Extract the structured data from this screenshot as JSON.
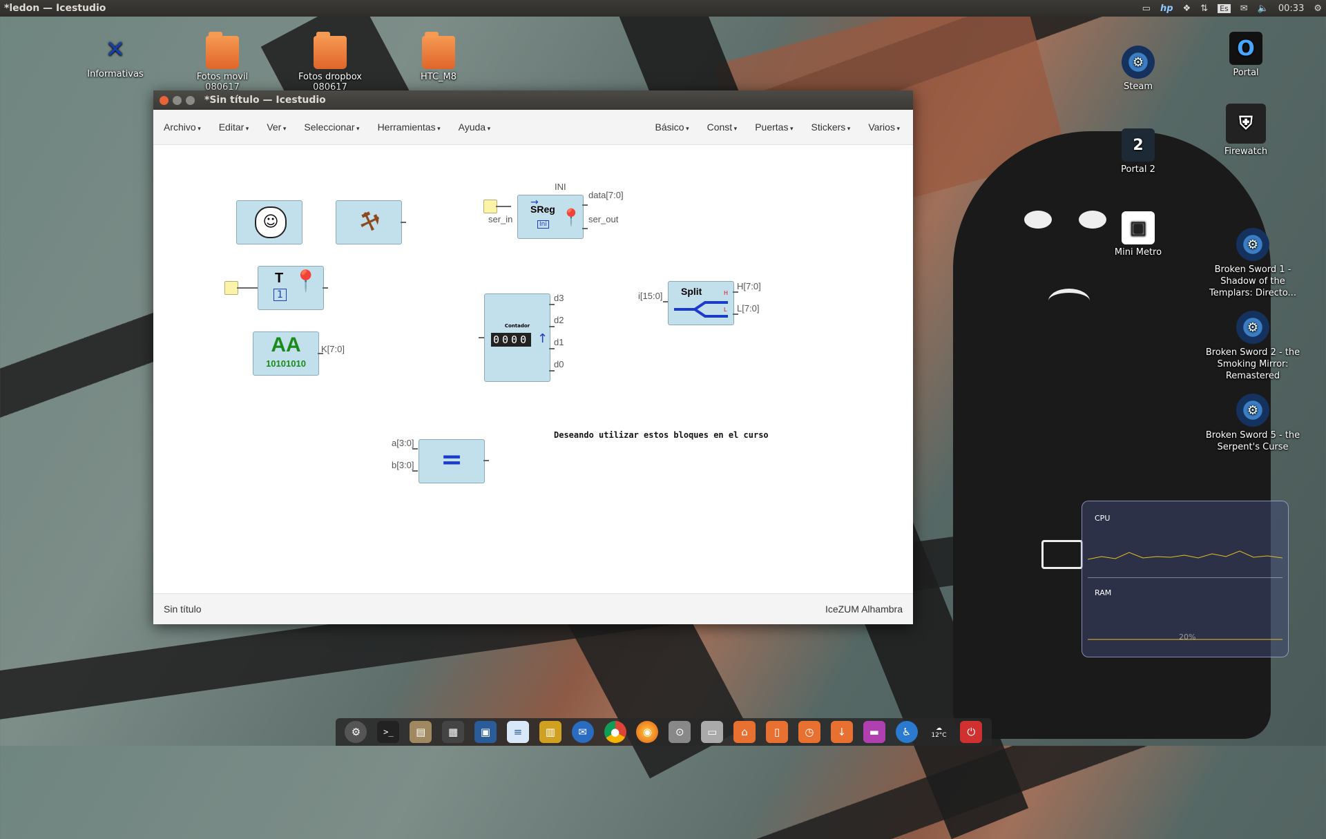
{
  "panel": {
    "title": "*ledon — Icestudio",
    "keyboard": "Es",
    "clock": "00:33"
  },
  "desktop_left": [
    {
      "label": "Informativas"
    },
    {
      "label": "Fotos movil 080617"
    },
    {
      "label": "Fotos dropbox 080617"
    },
    {
      "label": "HTC_M8"
    }
  ],
  "desktop_right": [
    {
      "label": "Steam"
    },
    {
      "label": "Portal"
    },
    {
      "label": "Firewatch"
    },
    {
      "label": "Portal 2"
    },
    {
      "label": "Mini Metro"
    },
    {
      "label": "Broken Sword 1 - Shadow of the Templars: Directo..."
    },
    {
      "label": "Broken Sword 2 - the Smoking Mirror: Remastered"
    },
    {
      "label": "Broken Sword 5 - the Serpent's Curse"
    }
  ],
  "window": {
    "title": "*Sin título — Icestudio",
    "menu_left": [
      "Archivo",
      "Editar",
      "Ver",
      "Seleccionar",
      "Herramientas",
      "Ayuda"
    ],
    "menu_right": [
      "Básico",
      "Const",
      "Puertas",
      "Stickers",
      "Varios"
    ],
    "status_left": "Sin título",
    "status_right": "IceZUM Alhambra"
  },
  "blocks": {
    "sreg": {
      "title": "SReg",
      "ini": "INI",
      "in": "ser_in",
      "out_data": "data[7:0]",
      "out_ser": "ser_out",
      "ini_badge": "Ini"
    },
    "t_block": {
      "label": "T",
      "badge": "1"
    },
    "const": {
      "label": "AA",
      "bits": "10101010",
      "out": "K[7:0]"
    },
    "counter": {
      "title": "Contador",
      "digits": "0000",
      "outs": [
        "d3",
        "d2",
        "d1",
        "d0"
      ]
    },
    "split": {
      "title": "Split",
      "in": "i[15:0]",
      "out_h": "H[7:0]",
      "out_l": "L[7:0]",
      "h": "H",
      "l": "L"
    },
    "compare": {
      "symbol": "=",
      "in_a": "a[3:0]",
      "in_b": "b[3:0]"
    },
    "note": "Deseando utilizar estos bloques en el curso"
  },
  "widget": {
    "cpu_label": "CPU",
    "ram_label": "RAM",
    "ram_value": "20%"
  },
  "dock": {
    "weather": "12°C"
  }
}
